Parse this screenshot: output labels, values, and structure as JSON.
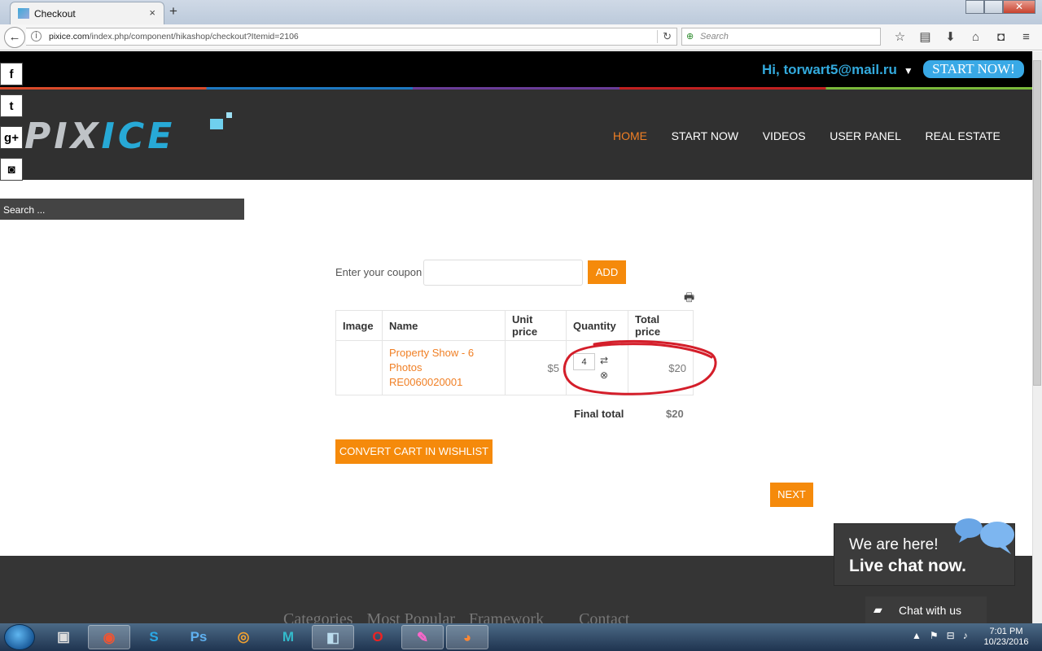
{
  "browser": {
    "tab_title": "Checkout",
    "tab_close": "×",
    "new_tab": "+",
    "url_host": "pixice.com",
    "url_path": "/index.php/component/hikashop/checkout?Itemid=2106",
    "search_placeholder": "Search"
  },
  "site": {
    "greeting": "Hi, torwart5@mail.ru",
    "start_now_button": "START NOW!",
    "logo_left": "PIX",
    "logo_right": "ICE",
    "nav": [
      "HOME",
      "START NOW",
      "VIDEOS",
      "USER PANEL",
      "REAL ESTATE"
    ],
    "active_nav": "HOME",
    "search_placeholder": "Search ..."
  },
  "coupon": {
    "label": "Enter your coupon",
    "value": "",
    "add_button": "ADD"
  },
  "cart": {
    "headers": [
      "Image",
      "Name",
      "Unit price",
      "Quantity",
      "Total price"
    ],
    "items": [
      {
        "name_line1": "Property Show - 6",
        "name_line2": "Photos RE0060020001",
        "unit_price": "$5",
        "quantity": "4",
        "total_price": "$20"
      }
    ],
    "final_total_label": "Final total",
    "final_total_value": "$20",
    "convert_button": "CONVERT CART IN WISHLIST",
    "next_button": "NEXT"
  },
  "footer": {
    "columns": [
      "Categories",
      "Most Popular",
      "Framework",
      "Contact"
    ]
  },
  "chat": {
    "line1": "We are here!",
    "line2": "Live chat now.",
    "button": "Chat with us"
  },
  "taskbar": {
    "time": "7:01 PM",
    "date": "10/23/2016"
  },
  "colors": {
    "accent": "#f58a0b",
    "link": "#f07f24",
    "brand_blue": "#39a9e6",
    "annotation": "#d41e2a"
  }
}
